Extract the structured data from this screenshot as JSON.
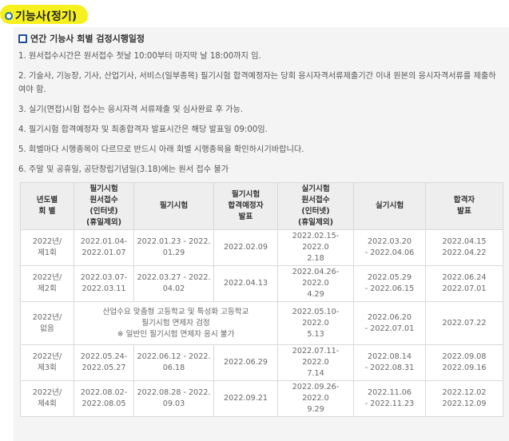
{
  "page_title": "기능사(정기)",
  "section_title": "연간 기능사 회별 검정시행일정",
  "notes": [
    "1. 원서접수시간은 원서접수 첫날 10:00부터 마지막 날 18:00까지 임.",
    "2. 기술사, 기능장, 기사, 산업기사, 서비스(일부종목) 필기시험 합격예정자는 당회 응시자격서류제출기간 이내 원본의 응시자격서류를 제출하여야 함.",
    "3. 실기(면접)시험 접수는 응시자격 서류제출 및 심사완료 후 가능.",
    "4. 필기시험 합격예정자 및 최종합격자 발표시간은 해당 발표일 09:00임.",
    "5. 회별마다 시행종목이 다르므로 반드시 아래 회별 시행종목을 확인하시기바랍니다.",
    "6. 주말 및 공휴일, 공단창립기념일(3.18)에는 원서 접수 불가"
  ],
  "table": {
    "headers": [
      "년도별\n회 별",
      "필기시험\n원서접수\n(인터넷)\n(휴일제외)",
      "필기시험",
      "필기시험\n합격예정자\n발표",
      "실기시험\n원서접수\n(인터넷)\n(휴일제외)",
      "실기시험",
      "합격자\n발표"
    ],
    "rows": [
      [
        "2022년/\n제1회",
        "2022.01.04-\n2022.01.07",
        "2022.01.23 - 2022.\n01.29",
        "2022.02.09",
        "2022.02.15-2022.0\n2.18",
        "2022.03.20\n- 2022.04.06",
        "2022.04.15\n2022.04.22"
      ],
      [
        "2022년/\n제2회",
        "2022.03.07-\n2022.03.11",
        "2022.03.27 - 2022.\n04.02",
        "2022.04.13",
        "2022.04.26-2022.0\n4.29",
        "2022.05.29\n- 2022.06.15",
        "2022.06.24\n2022.07.01"
      ],
      [
        "2022년/\n없음",
        "산업수요 맞춤형 고등학교 및 특성화 고등학교\n필기시험 면제자 검정\n※ 일반인 필기시험 면제자 응시 불가",
        "2022.05.10-2022.0\n5.13",
        "2022.06.20\n- 2022.07.01",
        "2022.07.22"
      ],
      [
        "2022년/\n제3회",
        "2022.05.24-\n2022.05.27",
        "2022.06.12 - 2022.\n06.18",
        "2022.06.29",
        "2022.07.11-2022.0\n7.14",
        "2022.08.14\n- 2022.08.31",
        "2022.09.08\n2022.09.16"
      ],
      [
        "2022년/\n제4회",
        "2022.08.02-\n2022.08.05",
        "2022.08.28 - 2022.\n09.03",
        "2022.09.21",
        "2022.09.26-2022.0\n9.29",
        "2022.11.06\n- 2022.11.23",
        "2022.12.02\n2022.12.09"
      ]
    ]
  },
  "colors": {
    "highlight": "#f6f11e",
    "icon": "#1d6fb8"
  }
}
